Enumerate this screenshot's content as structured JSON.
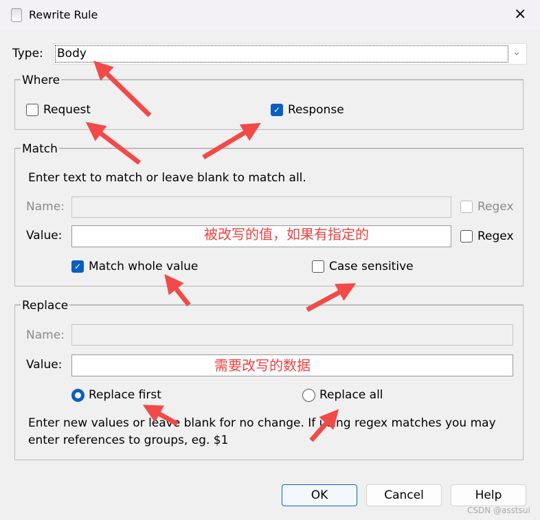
{
  "window": {
    "title": "Rewrite Rule",
    "close_icon": "×"
  },
  "type": {
    "label": "Type:",
    "value": "Body"
  },
  "where": {
    "legend": "Where",
    "request": {
      "label": "Request",
      "checked": false
    },
    "response": {
      "label": "Response",
      "checked": true
    }
  },
  "match": {
    "legend": "Match",
    "hint": "Enter text to match or leave blank to match all.",
    "name_label": "Name:",
    "name_value": "",
    "name_regex": "Regex",
    "value_label": "Value:",
    "value_value": "",
    "value_regex": "Regex",
    "match_whole": {
      "label": "Match whole value",
      "checked": true
    },
    "case_sensitive": {
      "label": "Case sensitive",
      "checked": false
    }
  },
  "replace": {
    "legend": "Replace",
    "name_label": "Name:",
    "name_value": "",
    "value_label": "Value:",
    "value_value": "",
    "replace_first": {
      "label": "Replace first",
      "selected": true
    },
    "replace_all": {
      "label": "Replace all",
      "selected": false
    },
    "hint1": "Enter new values or leave blank for no change. If using regex matches you may",
    "hint2": "enter references to groups, eg. $1"
  },
  "annotations": {
    "match_value": "被改写的值，如果有指定的",
    "replace_value": "需要改写的数据",
    "arrow_color": "#f24a48"
  },
  "buttons": {
    "ok": "OK",
    "cancel": "Cancel",
    "help": "Help"
  },
  "watermark": "CSDN @asstsui"
}
